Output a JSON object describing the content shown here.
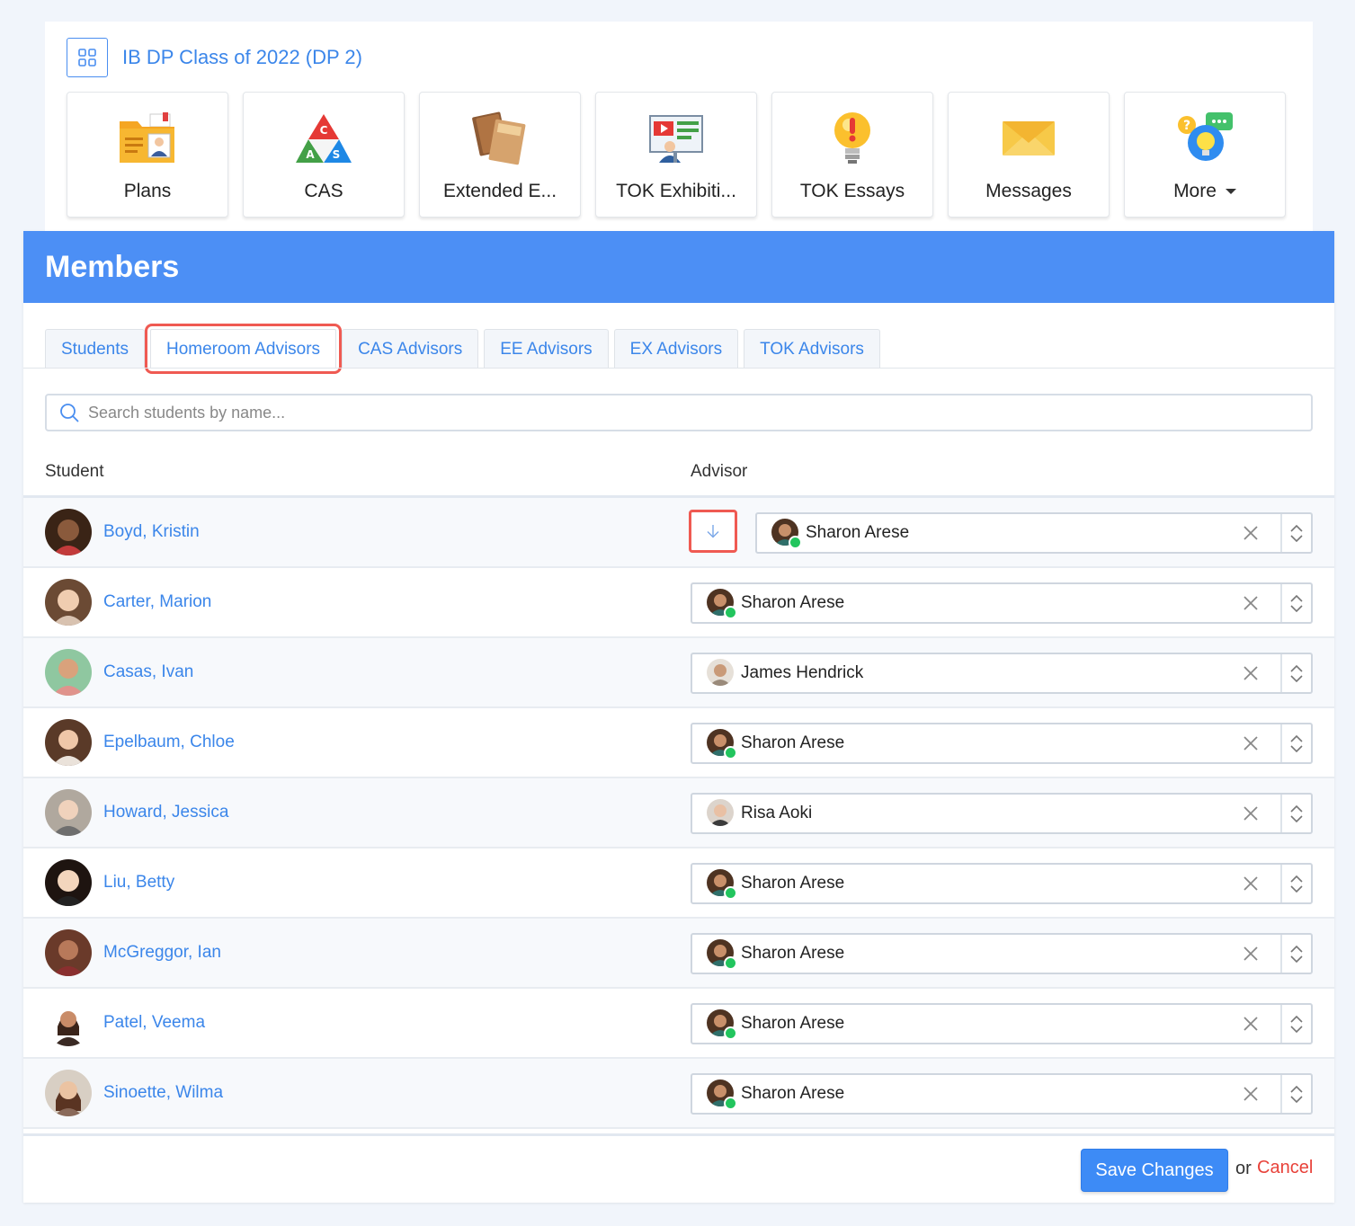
{
  "class_header": {
    "title": "IB DP Class of 2022 (DP 2)"
  },
  "tiles": [
    {
      "label": "Plans",
      "icon": "plans-folder-icon"
    },
    {
      "label": "CAS",
      "icon": "cas-triangle-icon"
    },
    {
      "label": "Extended E...",
      "icon": "extended-essay-notebook-icon"
    },
    {
      "label": "TOK Exhibiti...",
      "icon": "tok-exhibition-presentation-icon"
    },
    {
      "label": "TOK Essays",
      "icon": "tok-essays-exclamation-icon"
    },
    {
      "label": "Messages",
      "icon": "messages-envelope-icon"
    },
    {
      "label": "More",
      "icon": "more-lightbulb-icon"
    }
  ],
  "members": {
    "title": "Members",
    "tabs": [
      "Students",
      "Homeroom Advisors",
      "CAS Advisors",
      "EE Advisors",
      "EX Advisors",
      "TOK Advisors"
    ],
    "active_tab": "Homeroom Advisors",
    "search_placeholder": "Search students by name...",
    "columns": {
      "student": "Student",
      "advisor": "Advisor"
    },
    "rows": [
      {
        "student": "Boyd, Kristin",
        "advisor": "Sharon Arese"
      },
      {
        "student": "Carter, Marion",
        "advisor": "Sharon Arese"
      },
      {
        "student": "Casas, Ivan",
        "advisor": "James Hendrick"
      },
      {
        "student": "Epelbaum, Chloe",
        "advisor": "Sharon Arese"
      },
      {
        "student": "Howard, Jessica",
        "advisor": "Risa Aoki"
      },
      {
        "student": "Liu, Betty",
        "advisor": "Sharon Arese"
      },
      {
        "student": "McGreggor, Ian",
        "advisor": "Sharon Arese"
      },
      {
        "student": "Patel, Veema",
        "advisor": "Sharon Arese"
      },
      {
        "student": "Sinoette, Wilma",
        "advisor": "Sharon Arese"
      }
    ],
    "save_label": "Save Changes",
    "or_text": "or",
    "cancel_label": "Cancel"
  },
  "colors": {
    "accent": "#4c8ff5",
    "link": "#3b86ea",
    "highlight": "#ef5a52",
    "online": "#22c55e",
    "cancel": "#e8423a"
  }
}
